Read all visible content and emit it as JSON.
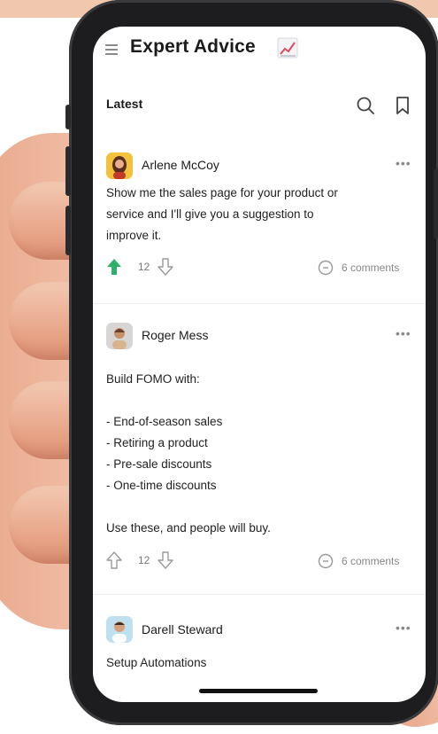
{
  "app": {
    "title": "Expert Advice",
    "title_emoji": "chart-increasing-icon",
    "section": "Latest"
  },
  "colors": {
    "upvote_active": "#2eaf6a",
    "icon_gray": "#8a8a8a",
    "text": "#1b1b1b"
  },
  "posts": [
    {
      "author": "Arlene McCoy",
      "time": "",
      "body": "Show me the sales page for your product or\nservice and I'll give you a suggestion to\nimprove it.",
      "votes": "12",
      "comments": "6 comments",
      "upvoted": true
    },
    {
      "author": "Roger Mess",
      "time": "",
      "body": "Build FOMO with:\n\n- End-of-season sales\n- Retiring a product\n- Pre-sale discounts\n- One-time discounts\n\nUse these, and people will buy.",
      "votes": "12",
      "comments": "6 comments",
      "upvoted": false
    },
    {
      "author": "Darell Steward",
      "time": "",
      "body": "Setup Automations"
    }
  ]
}
